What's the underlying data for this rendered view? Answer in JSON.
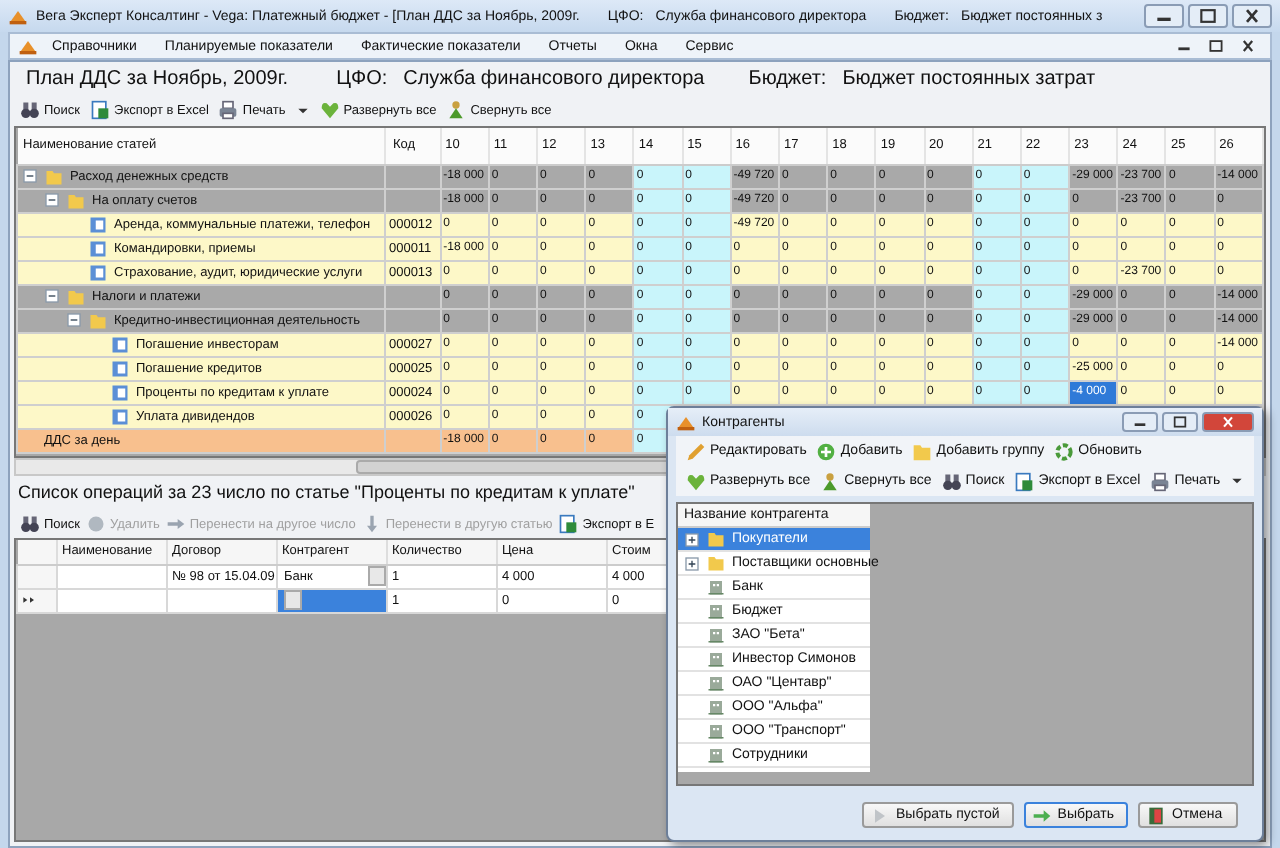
{
  "window": {
    "title_parts": [
      "Вега Эксперт Консалтинг - Vega: Платежный бюджет - [План ДДС за Ноябрь, 2009г.",
      "ЦФО:",
      "Служба финансового директора",
      "Бюджет:",
      "Бюджет постоянных з"
    ]
  },
  "menu": [
    "Справочники",
    "Планируемые показатели",
    "Фактические показатели",
    "Отчеты",
    "Окна",
    "Сервис"
  ],
  "header": {
    "plan": "План ДДС за Ноябрь, 2009г.",
    "cfo_label": "ЦФО:",
    "cfo": "Служба финансового директора",
    "budget_label": "Бюджет:",
    "budget": "Бюджет постоянных затрат"
  },
  "toolbar": [
    {
      "label": "Поиск",
      "kind": "search"
    },
    {
      "label": "Экспорт в Excel",
      "kind": "excel"
    },
    {
      "label": "Печать",
      "kind": "print",
      "dropdown": true
    },
    {
      "label": "Развернуть все",
      "kind": "expand"
    },
    {
      "label": "Свернуть все",
      "kind": "collapse"
    }
  ],
  "budget_grid": {
    "columns": [
      {
        "label": "Наименование статей"
      },
      {
        "label": "Код"
      },
      {
        "label": "10",
        "weekend": false
      },
      {
        "label": "11",
        "weekend": false
      },
      {
        "label": "12",
        "weekend": false
      },
      {
        "label": "13",
        "weekend": false
      },
      {
        "label": "14",
        "weekend": true
      },
      {
        "label": "15",
        "weekend": true
      },
      {
        "label": "16",
        "weekend": false
      },
      {
        "label": "17",
        "weekend": false
      },
      {
        "label": "18",
        "weekend": false
      },
      {
        "label": "19",
        "weekend": false
      },
      {
        "label": "20",
        "weekend": false
      },
      {
        "label": "21",
        "weekend": true
      },
      {
        "label": "22",
        "weekend": true
      },
      {
        "label": "23",
        "weekend": false
      },
      {
        "label": "24",
        "weekend": false
      },
      {
        "label": "25",
        "weekend": false
      },
      {
        "label": "26",
        "weekend": false
      }
    ],
    "rows": [
      {
        "kind": "group",
        "name": "Расход денежных средств",
        "expanded": true,
        "values": [
          "-18 000",
          "0",
          "0",
          "0",
          "0",
          "0",
          "-49 720",
          "0",
          "0",
          "0",
          "0",
          "0",
          "0",
          "-29 000",
          "-23 700",
          "0",
          "-14 000"
        ],
        "children": [
          {
            "kind": "group",
            "name": "На оплату счетов",
            "expanded": true,
            "values": [
              "-18 000",
              "0",
              "0",
              "0",
              "0",
              "0",
              "-49 720",
              "0",
              "0",
              "0",
              "0",
              "0",
              "0",
              "0",
              "-23 700",
              "0",
              "0"
            ],
            "children": [
              {
                "kind": "leaf",
                "name": "Аренда, коммунальные платежи, телефон",
                "code": "000012",
                "values": [
                  "0",
                  "0",
                  "0",
                  "0",
                  "0",
                  "0",
                  "-49 720",
                  "0",
                  "0",
                  "0",
                  "0",
                  "0",
                  "0",
                  "0",
                  "0",
                  "0",
                  "0"
                ]
              },
              {
                "kind": "leaf",
                "name": "Командировки, приемы",
                "code": "000011",
                "values": [
                  "-18 000",
                  "0",
                  "0",
                  "0",
                  "0",
                  "0",
                  "0",
                  "0",
                  "0",
                  "0",
                  "0",
                  "0",
                  "0",
                  "0",
                  "0",
                  "0",
                  "0"
                ]
              },
              {
                "kind": "leaf",
                "name": "Страхование, аудит, юридические услуги",
                "code": "000013",
                "values": [
                  "0",
                  "0",
                  "0",
                  "0",
                  "0",
                  "0",
                  "0",
                  "0",
                  "0",
                  "0",
                  "0",
                  "0",
                  "0",
                  "0",
                  "-23 700",
                  "0",
                  "0"
                ]
              }
            ]
          },
          {
            "kind": "group",
            "name": "Налоги и платежи",
            "expanded": true,
            "values": [
              "0",
              "0",
              "0",
              "0",
              "0",
              "0",
              "0",
              "0",
              "0",
              "0",
              "0",
              "0",
              "0",
              "-29 000",
              "0",
              "0",
              "-14 000"
            ],
            "children": [
              {
                "kind": "group",
                "name": "Кредитно-инвестиционная деятельность",
                "expanded": true,
                "values": [
                  "0",
                  "0",
                  "0",
                  "0",
                  "0",
                  "0",
                  "0",
                  "0",
                  "0",
                  "0",
                  "0",
                  "0",
                  "0",
                  "-29 000",
                  "0",
                  "0",
                  "-14 000"
                ],
                "children": [
                  {
                    "kind": "leaf",
                    "name": "Погашение инвесторам",
                    "code": "000027",
                    "values": [
                      "0",
                      "0",
                      "0",
                      "0",
                      "0",
                      "0",
                      "0",
                      "0",
                      "0",
                      "0",
                      "0",
                      "0",
                      "0",
                      "0",
                      "0",
                      "0",
                      "-14 000"
                    ]
                  },
                  {
                    "kind": "leaf",
                    "name": "Погашение кредитов",
                    "code": "000025",
                    "values": [
                      "0",
                      "0",
                      "0",
                      "0",
                      "0",
                      "0",
                      "0",
                      "0",
                      "0",
                      "0",
                      "0",
                      "0",
                      "0",
                      "-25 000",
                      "0",
                      "0",
                      "0"
                    ]
                  },
                  {
                    "kind": "leaf",
                    "name": "Проценты по кредитам к уплате",
                    "code": "000024",
                    "values": [
                      "0",
                      "0",
                      "0",
                      "0",
                      "0",
                      "0",
                      "0",
                      "0",
                      "0",
                      "0",
                      "0",
                      "0",
                      "0",
                      {
                        "text": "-4 000",
                        "selected": true
                      },
                      "0",
                      "0",
                      "0"
                    ]
                  },
                  {
                    "kind": "leaf",
                    "name": "Уплата дивидендов",
                    "code": "000026",
                    "values": [
                      "0",
                      "0",
                      "0",
                      "0",
                      "0"
                    ]
                  }
                ]
              }
            ]
          }
        ]
      },
      {
        "kind": "total",
        "name": "ДДС за день",
        "values": [
          "-18 000",
          "0",
          "0",
          "0",
          "0"
        ]
      }
    ]
  },
  "operations": {
    "title": "Список операций за 23 число по статье \"Проценты по кредитам к уплате\"",
    "toolbar": [
      {
        "label": "Поиск",
        "kind": "search",
        "disabled": false
      },
      {
        "label": "Удалить",
        "kind": "delete",
        "disabled": true
      },
      {
        "label": "Перенести на другое число",
        "kind": "move-date",
        "disabled": true
      },
      {
        "label": "Перенести в другую статью",
        "kind": "move-item",
        "disabled": true
      },
      {
        "label": "Экспорт в E",
        "kind": "excel",
        "disabled": false
      }
    ],
    "columns": [
      "Наименование",
      "Договор",
      "Контрагент",
      "Количество",
      "Цена",
      "Стоим"
    ],
    "rows": [
      {
        "kind": "data",
        "cells": [
          {
            "selected": false
          },
          {
            "text": "№ 98 от 15.04.09",
            "selected": false
          },
          {
            "text": "Банк",
            "lookup": true,
            "selected": false
          },
          {
            "text": "1",
            "selected": false
          },
          {
            "text": "4 000",
            "selected": false
          },
          {
            "text": "4 000",
            "selected": false
          }
        ]
      },
      {
        "kind": "new",
        "cells": [
          {
            "selected": false
          },
          {
            "selected": false
          },
          {
            "lookup": true,
            "selected": true
          },
          {
            "text": "1",
            "selected": false
          },
          {
            "text": "0",
            "selected": false
          },
          {
            "text": "0",
            "selected": false
          }
        ]
      }
    ]
  },
  "dialog": {
    "title": "Контрагенты",
    "toolbar_rows": [
      [
        {
          "label": "Редактировать",
          "kind": "edit"
        },
        {
          "label": "Добавить",
          "kind": "add"
        },
        {
          "label": "Добавить группу",
          "kind": "folder"
        },
        {
          "label": "Обновить",
          "kind": "refresh"
        }
      ],
      [
        {
          "label": "Развернуть все",
          "kind": "expand"
        },
        {
          "label": "Свернуть все",
          "kind": "collapse"
        },
        {
          "label": "Поиск",
          "kind": "search"
        },
        {
          "label": "Экспорт в Excel",
          "kind": "excel"
        },
        {
          "label": "Печать",
          "kind": "print",
          "dropdown": true
        }
      ]
    ],
    "list": {
      "header": "Название контрагента",
      "items": [
        {
          "kind": "group",
          "label": "Покупатели",
          "expanded": false,
          "selected": true
        },
        {
          "kind": "group",
          "label": "Поставщики основные",
          "expanded": false,
          "selected": false
        },
        {
          "kind": "item",
          "label": "Банк",
          "selected": false
        },
        {
          "kind": "item",
          "label": "Бюджет",
          "selected": false
        },
        {
          "kind": "item",
          "label": "ЗАО \"Бета\"",
          "selected": false
        },
        {
          "kind": "item",
          "label": "Инвестор Симонов",
          "selected": false
        },
        {
          "kind": "item",
          "label": "ОАО \"Центавр\"",
          "selected": false
        },
        {
          "kind": "item",
          "label": "ООО \"Альфа\"",
          "selected": false
        },
        {
          "kind": "item",
          "label": "ООО \"Транспорт\"",
          "selected": false
        },
        {
          "kind": "item",
          "label": "Сотрудники",
          "selected": false
        }
      ]
    },
    "buttons": [
      {
        "label": "Выбрать пустой",
        "kind": "empty",
        "default": false
      },
      {
        "label": "Выбрать",
        "kind": "select",
        "default": true
      },
      {
        "label": "Отмена",
        "kind": "cancel",
        "default": false
      }
    ]
  }
}
